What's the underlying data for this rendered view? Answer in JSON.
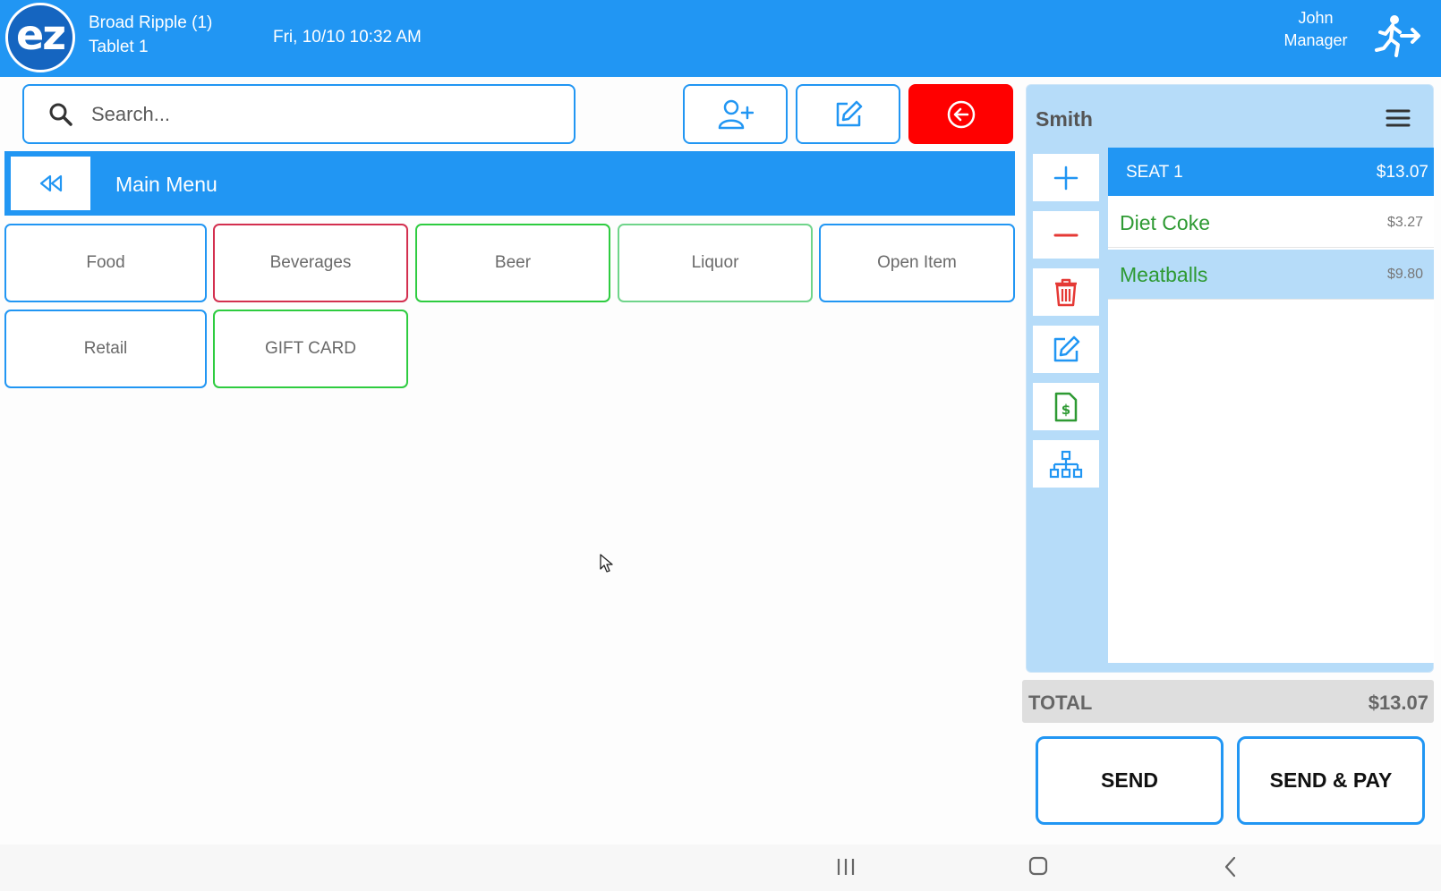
{
  "header": {
    "logo_text": "ez",
    "location": "Broad Ripple (1)",
    "device": "Tablet 1",
    "datetime": "Fri, 10/10 10:32 AM",
    "user_name": "John",
    "user_role": "Manager",
    "bg_color": "#2196f3"
  },
  "search": {
    "placeholder": "Search..."
  },
  "toolbar": {
    "icons": [
      "add-customer-icon",
      "edit-icon",
      "exit-order-icon"
    ],
    "exit_color": "#ff0000"
  },
  "menu": {
    "title": "Main Menu",
    "categories": [
      {
        "label": "Food",
        "color": "#2196f3"
      },
      {
        "label": "Beverages",
        "color": "#d32f4f"
      },
      {
        "label": "Beer",
        "color": "#2ecc40"
      },
      {
        "label": "Liquor",
        "color": "#6fd48a"
      },
      {
        "label": "Open Item",
        "color": "#2196f3"
      },
      {
        "label": "Retail",
        "color": "#2196f3"
      },
      {
        "label": "GIFT CARD",
        "color": "#2ecc40"
      }
    ]
  },
  "order": {
    "customer": "Smith",
    "seat_label": "SEAT 1",
    "seat_total": "$13.07",
    "items": [
      {
        "name": "Diet Coke",
        "price": "$3.27"
      },
      {
        "name": "Meatballs",
        "price": "$9.80"
      }
    ],
    "total_label": "TOTAL",
    "total_value": "$13.07",
    "side_icons": [
      "plus-icon",
      "minus-icon",
      "trash-icon",
      "edit-icon",
      "invoice-dollar-icon",
      "hierarchy-icon"
    ]
  },
  "actions": {
    "send": "SEND",
    "send_pay": "SEND & PAY"
  }
}
